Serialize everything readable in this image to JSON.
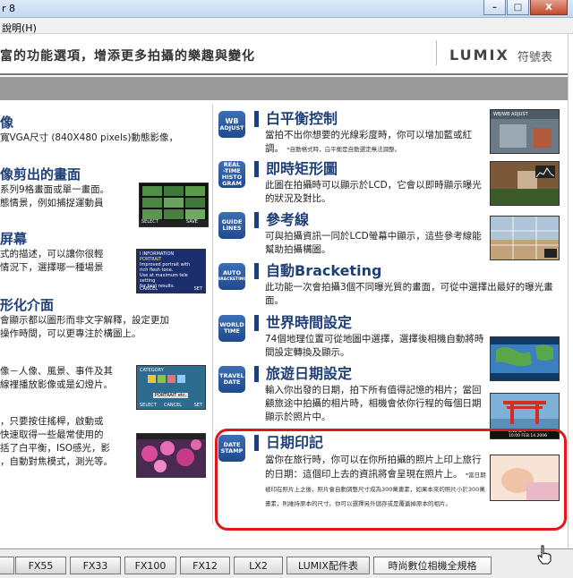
{
  "window": {
    "title": "r 8",
    "menu": "說明(H)",
    "buttons": [
      "–",
      "□",
      "X"
    ]
  },
  "header": {
    "slogan": "富的功能選項，增添更多拍攝的樂趣與變化",
    "brand": "LUMIX",
    "brand_sub": "符號表"
  },
  "left": [
    {
      "title": "像",
      "lines": [
        "寬VGA尺寸 (840X480 pixels)動態影像，"
      ]
    },
    {
      "title": "像剪出的畫面",
      "lines": [
        "系列9格畫面或單一畫面。",
        "態情景，例如捕捉運動員"
      ]
    },
    {
      "title": "屏幕",
      "lines": [
        "式的描述，可以讓你很輕",
        "情況下，選擇哪一種場景"
      ]
    },
    {
      "title": "形化介面",
      "lines": [
        "會顯示都以圖形而非文字解釋，設定更加",
        "操作時間，可以更專注於構圖上。"
      ]
    },
    {
      "title": "",
      "lines": [
        "像－人像、風景、事件及其",
        "線裡播放影像或是幻燈片。"
      ]
    },
    {
      "title": "",
      "lines": [
        "，只要按住搖桿，啟動或",
        "快速取得一些最常使用的",
        "括了白平衡，ISO感光，影",
        "，自動對焦模式，測光等。"
      ]
    }
  ],
  "features": [
    {
      "badge": [
        "WB",
        "ADJUST"
      ],
      "title": "白平衡控制",
      "desc": "當拍不出你想要的光線彩度時，你可以增加藍或紅調。",
      "note": "*自動格式時，白平衡是自動選定無法調整。"
    },
    {
      "badge": [
        "REAL",
        "-TIME",
        "HISTO",
        "GRAM"
      ],
      "title": "即時矩形圖",
      "desc": "此圖在拍攝時可以顯示於LCD，它會以即時顯示曝光的狀況及對比。"
    },
    {
      "badge": [
        "GUIDE",
        "LINES"
      ],
      "title": "參考線",
      "desc": "可與拍攝資訊一同於LCD螢幕中顯示，這些參考線能幫助拍攝構圖。"
    },
    {
      "badge": [
        "AUTO",
        "BRACKETING"
      ],
      "title": "自動Bracketing",
      "desc": "此功能一次會拍攝3個不同曝光質的畫面，可從中選擇出最好的曝光畫面。"
    },
    {
      "badge": [
        "WORLD",
        "TIME"
      ],
      "title": "世界時間設定",
      "desc": "74個地理位置可從地圖中選擇，選擇後相機自動將時間設定轉換及顯示。"
    },
    {
      "badge": [
        "TRAVEL",
        "DATE"
      ],
      "title": "旅遊日期設定",
      "desc": "輸入你出發的日期，拍下所有值得記憶的相片；當回顧旅途中拍攝的相片時，相機會依你行程的每個日期顯示於照片中。"
    },
    {
      "badge": [
        "DATE",
        "STAMP"
      ],
      "title": "日期印記",
      "desc": "當你在旅行時，你可以在你所拍攝的照片上印上旅行的日期：這個印上去的資訊將會呈現在照片上。",
      "note": "*當日期被印在照片上之後，照片會自動調整尺寸成為300萬畫素，如果本來的照片小於300萬畫素，則維持原本的尺寸。你可以選擇另外儲存或是覆蓋掉原本的相片。"
    }
  ],
  "thumbs": {
    "portrait": [
      "I INFORMATION",
      "PORTRAIT",
      "Improved portrait with",
      "rich flesh tone.",
      "Use at maximum tele setting",
      "for best results.",
      "CANCEL",
      "SET"
    ],
    "categories": [
      "CATEGORY",
      "PORTRAIT etc.",
      "SELECT",
      "CANCEL",
      "SET"
    ],
    "wb": "WB/WB ADJUST",
    "travel": [
      "2ND DAY",
      "10:00 FEB.14.2006"
    ],
    "thumb9": [
      "SELECT",
      "SAVE"
    ]
  },
  "tabs": [
    "FX55",
    "FX33",
    "FX100",
    "FX12",
    "LX2",
    "LUMIX配件表",
    "時尚數位相機全規格"
  ],
  "colors": {
    "accent": "#1f3f78",
    "highlight": "#e01818"
  }
}
